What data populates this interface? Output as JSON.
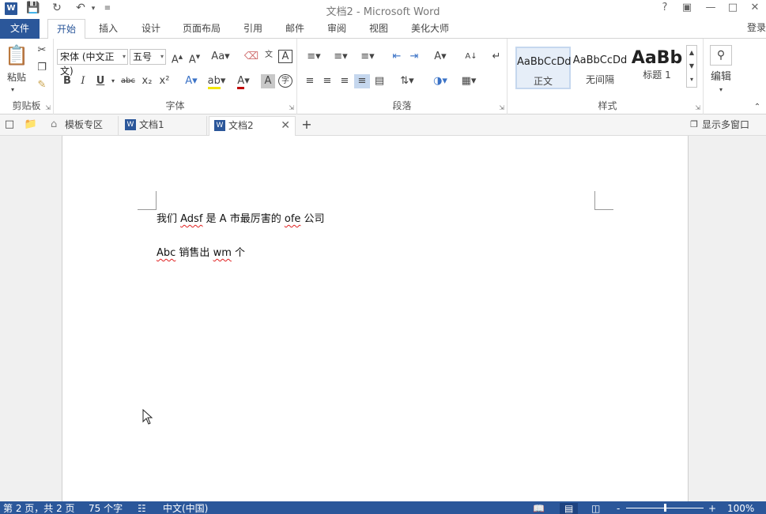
{
  "window": {
    "title": "文档2 - Microsoft Word",
    "logo_letter": "W",
    "help_label": "?",
    "login_label": "登录"
  },
  "ribbon_tabs": [
    "文件",
    "开始",
    "插入",
    "设计",
    "页面布局",
    "引用",
    "邮件",
    "审阅",
    "视图",
    "美化大师"
  ],
  "active_tab": "开始",
  "clipboard": {
    "paste_label": "粘贴",
    "group_label": "剪贴板"
  },
  "font": {
    "font_name": "宋体 (中文正文)",
    "font_size": "五号",
    "group_label": "字体",
    "bold": "B",
    "italic": "I",
    "underline": "U",
    "strike": "abc",
    "sub": "x₂",
    "sup": "x²"
  },
  "paragraph": {
    "group_label": "段落"
  },
  "styles": {
    "group_label": "样式",
    "items": [
      {
        "sample": "AaBbCcDd",
        "name": "正文"
      },
      {
        "sample": "AaBbCcDd",
        "name": "无间隔"
      },
      {
        "sample": "AaBb",
        "name": "标题 1"
      }
    ]
  },
  "editing": {
    "label": "编辑"
  },
  "doc_tabs": [
    {
      "label": "模板专区"
    },
    {
      "label": "文档1"
    },
    {
      "label": "文档2"
    }
  ],
  "show_multi_window": "显示多窗口",
  "document": {
    "line1_prefix": "我们 ",
    "line1_word1": "Adsf",
    "line1_middle": " 是 A 市最厉害的 ",
    "line1_word2": "ofe",
    "line1_suffix": " 公司",
    "line2_word1": "Abc",
    "line2_middle": " 销售出 ",
    "line2_word2": "wm",
    "line2_suffix": " 个"
  },
  "status": {
    "page": "第 2 页，共 2 页",
    "words": "75 个字",
    "language": "中文(中国)",
    "zoom": "100%",
    "zoom_minus": "-",
    "zoom_plus": "+"
  },
  "colors": {
    "accent": "#2b579a",
    "spell_underline": "#e02020",
    "workspace": "#f0f0f0"
  }
}
